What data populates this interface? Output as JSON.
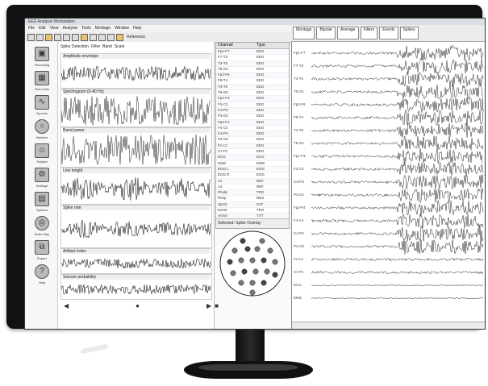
{
  "app": {
    "title": "EEG Analysis Workstation"
  },
  "menu": [
    "File",
    "Edit",
    "View",
    "Analysis",
    "Tools",
    "Montage",
    "Window",
    "Help"
  ],
  "toolbar": {
    "icons": [
      "new-icon",
      "open-icon",
      "save-icon",
      "print-icon",
      "cut-icon",
      "copy-icon",
      "paste-icon",
      "undo-icon",
      "redo-icon",
      "zoom-icon",
      "filter-icon"
    ],
    "label": "Reference"
  },
  "right_tabs": [
    "Montage",
    "Bipolar",
    "Average",
    "Filters",
    "Events",
    "Spikes"
  ],
  "sidebar": {
    "items": [
      {
        "label": "Recording",
        "icon": "monitor-icon"
      },
      {
        "label": "Raw Data",
        "icon": "grid-icon"
      },
      {
        "label": "Epochs",
        "icon": "waves-icon"
      },
      {
        "label": "Markers",
        "icon": "circle-icon"
      },
      {
        "label": "Subject",
        "icon": "person-icon"
      },
      {
        "label": "Settings",
        "icon": "gear-icon"
      },
      {
        "label": "Spectra",
        "icon": "chart-icon"
      },
      {
        "label": "Brain Map",
        "icon": "globe-icon"
      },
      {
        "label": "Export",
        "icon": "expand-icon"
      },
      {
        "label": "Help",
        "icon": "help-icon"
      }
    ]
  },
  "left_panel": {
    "toolbar_items": [
      "Spike Detection",
      "Filter",
      "Band",
      "Scale"
    ],
    "tracks": [
      "Amplitude envelope",
      "Spectrogram (0-40 Hz)",
      "Band power",
      "Line length",
      "Spike rate",
      "Artifact index",
      "Seizure probability"
    ]
  },
  "channel_list": {
    "headers": [
      "Channel",
      "Type"
    ],
    "rows": [
      [
        "Fp1-F7",
        "EEG"
      ],
      [
        "F7-T3",
        "EEG"
      ],
      [
        "T3-T5",
        "EEG"
      ],
      [
        "T5-O1",
        "EEG"
      ],
      [
        "Fp2-F8",
        "EEG"
      ],
      [
        "F8-T4",
        "EEG"
      ],
      [
        "T4-T6",
        "EEG"
      ],
      [
        "T6-O2",
        "EEG"
      ],
      [
        "Fp1-F3",
        "EEG"
      ],
      [
        "F3-C3",
        "EEG"
      ],
      [
        "C3-P3",
        "EEG"
      ],
      [
        "P3-O1",
        "EEG"
      ],
      [
        "Fp2-F4",
        "EEG"
      ],
      [
        "F4-C4",
        "EEG"
      ],
      [
        "C4-P4",
        "EEG"
      ],
      [
        "P4-O2",
        "EEG"
      ],
      [
        "Fz-Cz",
        "EEG"
      ],
      [
        "Cz-Pz",
        "EEG"
      ],
      [
        "ECG",
        "ECG"
      ],
      [
        "EMG",
        "EMG"
      ],
      [
        "EOG L",
        "EOG"
      ],
      [
        "EOG R",
        "EOG"
      ],
      [
        "A1",
        "REF"
      ],
      [
        "A2",
        "REF"
      ],
      [
        "Photic",
        "TRG"
      ],
      [
        "Resp",
        "RES"
      ],
      [
        "SpO2",
        "SAT"
      ],
      [
        "Event",
        "TRG"
      ],
      [
        "Annot",
        "TXT"
      ],
      [
        "Marker",
        "TRG"
      ],
      [
        "Status",
        "SYS"
      ]
    ],
    "footer": "Selected: Spike Overlay"
  },
  "eeg_panel": {
    "channels": [
      "Fp1-F7",
      "F7-T3",
      "T3-T5",
      "T5-O1",
      "Fp2-F8",
      "F8-T4",
      "T4-T6",
      "T6-O2",
      "Fp1-F3",
      "F3-C3",
      "C3-P3",
      "P3-O1",
      "Fp2-F4",
      "F4-C4",
      "C4-P4",
      "P4-O2",
      "Fz-Cz",
      "Cz-Pz",
      "ECG",
      "EMG"
    ]
  },
  "colors": {
    "bezel": "#111111",
    "signal": "#222222",
    "accent": "#e9c46a"
  }
}
